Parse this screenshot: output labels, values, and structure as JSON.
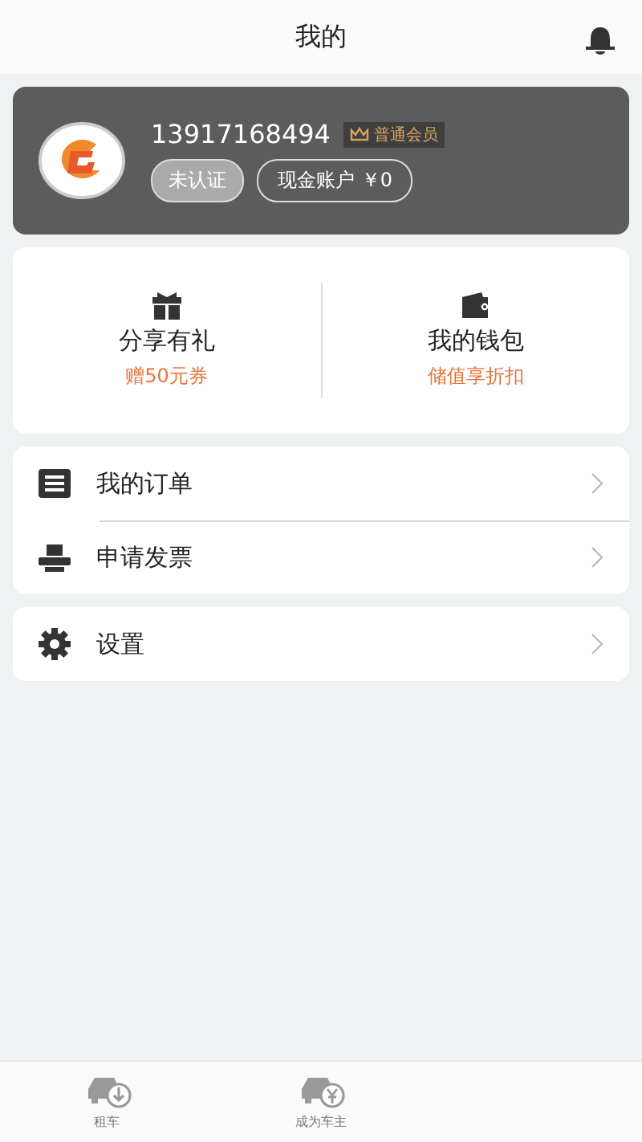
{
  "header": {
    "title": "我的"
  },
  "profile": {
    "phone": "13917168494",
    "member_badge": "普通会员",
    "verify_status": "未认证",
    "cash_account": "现金账户 ￥0"
  },
  "promos": [
    {
      "kind": "gift",
      "title": "分享有礼",
      "subtitle": "赠50元券"
    },
    {
      "kind": "wallet",
      "title": "我的钱包",
      "subtitle": "储值享折扣"
    }
  ],
  "menu_groups": [
    {
      "items": [
        {
          "kind": "orders",
          "label": "我的订单"
        },
        {
          "kind": "invoice",
          "label": "申请发票"
        }
      ]
    },
    {
      "items": [
        {
          "kind": "settings",
          "label": "设置"
        }
      ]
    }
  ],
  "tab_bar": [
    {
      "kind": "rent",
      "label": "租车"
    },
    {
      "kind": "owner",
      "label": "成为车主"
    }
  ]
}
